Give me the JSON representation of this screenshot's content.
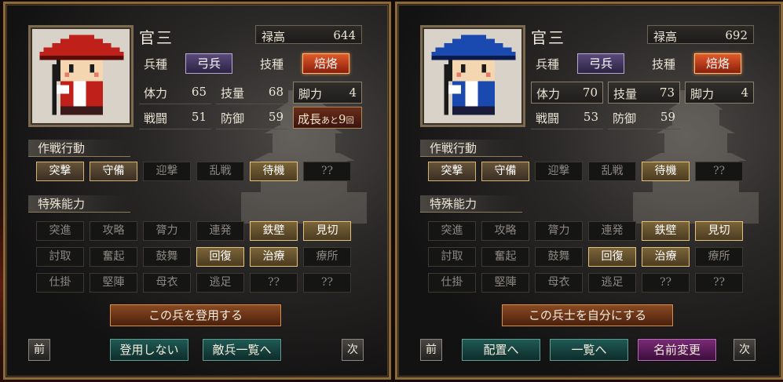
{
  "left": {
    "name": "官三",
    "salary": {
      "label": "禄高",
      "value": "644"
    },
    "troop": {
      "label": "兵種",
      "value": "弓兵"
    },
    "skill": {
      "label": "技種",
      "value": "焙烙"
    },
    "stats": {
      "hp": {
        "label": "体力",
        "value": "65"
      },
      "tech": {
        "label": "技量",
        "value": "68"
      },
      "leg": {
        "label": "脚力",
        "value": "4"
      },
      "combat": {
        "label": "戦闘",
        "value": "51"
      },
      "defense": {
        "label": "防御",
        "value": "59"
      },
      "growth": {
        "label": "成長",
        "mid": "あと",
        "count": "9",
        "unit": "回"
      }
    },
    "tactics_title": "作戦行動",
    "tactics": [
      "突撃",
      "守備",
      "迎撃",
      "乱戦",
      "待機",
      "??"
    ],
    "abilities_title": "特殊能力",
    "abilities": [
      "突進",
      "攻略",
      "膂力",
      "連発",
      "鉄壁",
      "見切",
      "討取",
      "奮起",
      "鼓舞",
      "回復",
      "治療",
      "療所",
      "仕掛",
      "堅陣",
      "母衣",
      "逃足",
      "??",
      "??"
    ],
    "main_button": "この兵を登用する",
    "prev": "前",
    "next": "次",
    "btn1": "登用しない",
    "btn2": "敵兵一覧へ"
  },
  "right": {
    "name": "官三",
    "salary": {
      "label": "禄高",
      "value": "692"
    },
    "troop": {
      "label": "兵種",
      "value": "弓兵"
    },
    "skill": {
      "label": "技種",
      "value": "焙烙"
    },
    "stats": {
      "hp": {
        "label": "体力",
        "value": "70"
      },
      "tech": {
        "label": "技量",
        "value": "73"
      },
      "leg": {
        "label": "脚力",
        "value": "4"
      },
      "combat": {
        "label": "戦闘",
        "value": "53"
      },
      "defense": {
        "label": "防御",
        "value": "59"
      }
    },
    "tactics_title": "作戦行動",
    "tactics": [
      "突撃",
      "守備",
      "迎撃",
      "乱戦",
      "待機",
      "??"
    ],
    "abilities_title": "特殊能力",
    "abilities": [
      "突進",
      "攻略",
      "膂力",
      "連発",
      "鉄壁",
      "見切",
      "討取",
      "奮起",
      "鼓舞",
      "回復",
      "治療",
      "療所",
      "仕掛",
      "堅陣",
      "母衣",
      "逃足",
      "??",
      "??"
    ],
    "main_button": "この兵士を自分にする",
    "prev": "前",
    "next": "次",
    "btn1": "配置へ",
    "btn2": "一覧へ",
    "btn3": "名前変更"
  },
  "colors": {
    "hat_left": "#c0201a",
    "hat_right": "#1a4ab0",
    "accent_gold": "#d6b272"
  }
}
